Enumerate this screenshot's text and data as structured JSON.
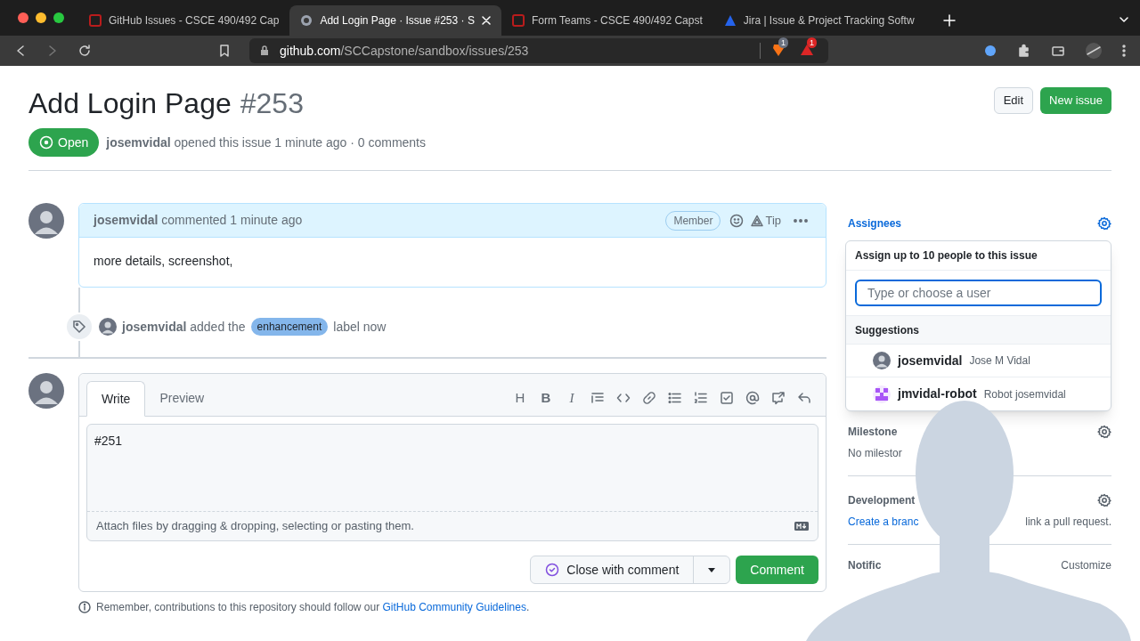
{
  "browser": {
    "tabs": [
      {
        "title": "GitHub Issues - CSCE 490/492 Cap",
        "selected": false,
        "kind": "course"
      },
      {
        "title": "Add Login Page · Issue #253 · S",
        "selected": true,
        "kind": "github"
      },
      {
        "title": "Form Teams - CSCE 490/492 Capst",
        "selected": false,
        "kind": "course"
      },
      {
        "title": "Jira | Issue & Project Tracking Softw",
        "selected": false,
        "kind": "jira"
      }
    ],
    "url": {
      "host": "github.com",
      "path": "/SCCapstone/sandbox/issues/253"
    },
    "extension_badges": [
      "1",
      "1"
    ]
  },
  "issue": {
    "title": "Add Login Page",
    "number": "#253",
    "status": "Open",
    "meta": "**josemvidal** opened this issue 1 minute ago · 0 comments",
    "buttons": [
      "Edit",
      "New issue"
    ]
  },
  "comment": {
    "header": "**josemvidal** commented 1 minute ago",
    "role": "Member",
    "tip": "Tip",
    "body": "more details, screenshot,"
  },
  "event": {
    "text": "**josemvidal** added the",
    "label": {
      "name": "enhancement",
      "color": "#84b6eb"
    },
    "suffix": "label now"
  },
  "editor": {
    "tabs": [
      {
        "label": "Write",
        "selected": true
      },
      {
        "label": "Preview",
        "selected": false
      }
    ],
    "toolbar_glyphs": [
      "H",
      "B",
      "I"
    ],
    "value": "#251",
    "attach_hint": "Attach files by dragging & dropping, selecting or pasting them.",
    "close_button": "Close with comment",
    "submit_button": "Comment"
  },
  "footer_note": {
    "text": "Remember, contributions to this repository should follow our ",
    "link": "GitHub Community Guidelines",
    "end": "."
  },
  "sidebar": {
    "assignees": {
      "title": "Assignees",
      "popup": {
        "title": "Assign up to 10 people to this issue",
        "placeholder": "Type or choose a user",
        "section": "Suggestions",
        "users": [
          {
            "login": "josemvidal",
            "name": "Jose M Vidal",
            "kind": "photo"
          },
          {
            "login": "jmvidal-robot",
            "name": "Robot josemvidal",
            "kind": "identicon"
          }
        ]
      }
    },
    "milestone": {
      "title": "Milestone",
      "value": "No milestor"
    },
    "development": {
      "title": "Development",
      "link": "Create a branc",
      "text": "link a pull request."
    },
    "notifications": {
      "title": "Notific",
      "action": "Customize"
    }
  }
}
